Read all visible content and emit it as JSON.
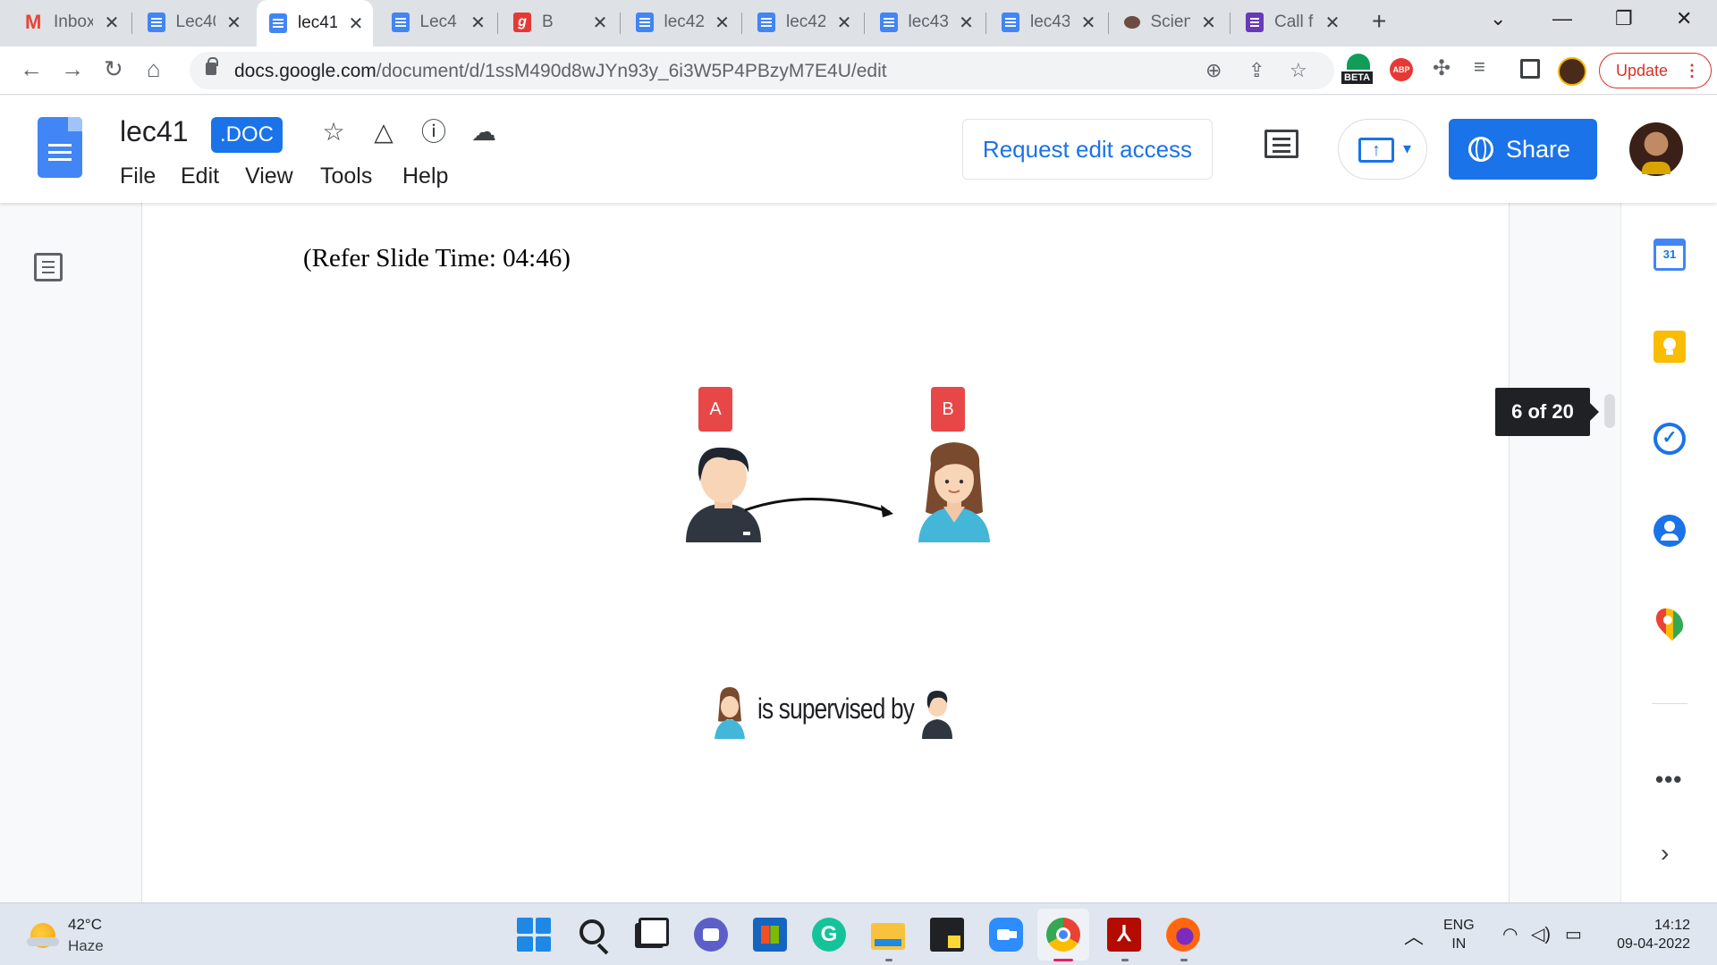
{
  "browser": {
    "tabs": [
      {
        "title": "Inbox",
        "icon": "gmail-icon"
      },
      {
        "title": "Lec40",
        "icon": "docs-icon"
      },
      {
        "title": "lec41",
        "icon": "docs-icon",
        "active": true
      },
      {
        "title": "Lec4",
        "icon": "docs-icon"
      },
      {
        "title": "B",
        "icon": "g-icon"
      },
      {
        "title": "lec42",
        "icon": "docs-icon"
      },
      {
        "title": "lec42",
        "icon": "docs-icon"
      },
      {
        "title": "lec43",
        "icon": "docs-icon"
      },
      {
        "title": "lec43",
        "icon": "docs-icon"
      },
      {
        "title": "Scien",
        "icon": "science-icon"
      },
      {
        "title": "Call f",
        "icon": "forms-icon"
      }
    ],
    "new_tab_label": "+",
    "url_host": "docs.google.com",
    "url_path": "/document/d/1ssM490d8wJYn93y_6i3W5P4PBzyM7E4U/edit",
    "update_label": "Update",
    "beta_badge": "BETA",
    "abp_badge": "ABP"
  },
  "docs": {
    "title": "lec41",
    "badge": ".DOC",
    "menu": [
      "File",
      "Edit",
      "View",
      "Tools",
      "Help"
    ],
    "request_access_label": "Request edit access",
    "share_label": "Share"
  },
  "content": {
    "slide_ref": "(Refer Slide Time: 04:46)",
    "label_a": "A",
    "label_b": "B",
    "caption": "is supervised by",
    "page_indicator": "6 of 20"
  },
  "side_panel": {
    "calendar_day": "31",
    "more_label": "•••",
    "expand_label": "›"
  },
  "taskbar": {
    "temperature": "42°C",
    "weather": "Haze",
    "lang_line1": "ENG",
    "lang_line2": "IN",
    "time": "14:12",
    "date": "09-04-2022",
    "grammarly_letter": "G"
  },
  "colors": {
    "accent": "#1a73e8",
    "tag_red": "#e84747",
    "update_red": "#d93025"
  }
}
